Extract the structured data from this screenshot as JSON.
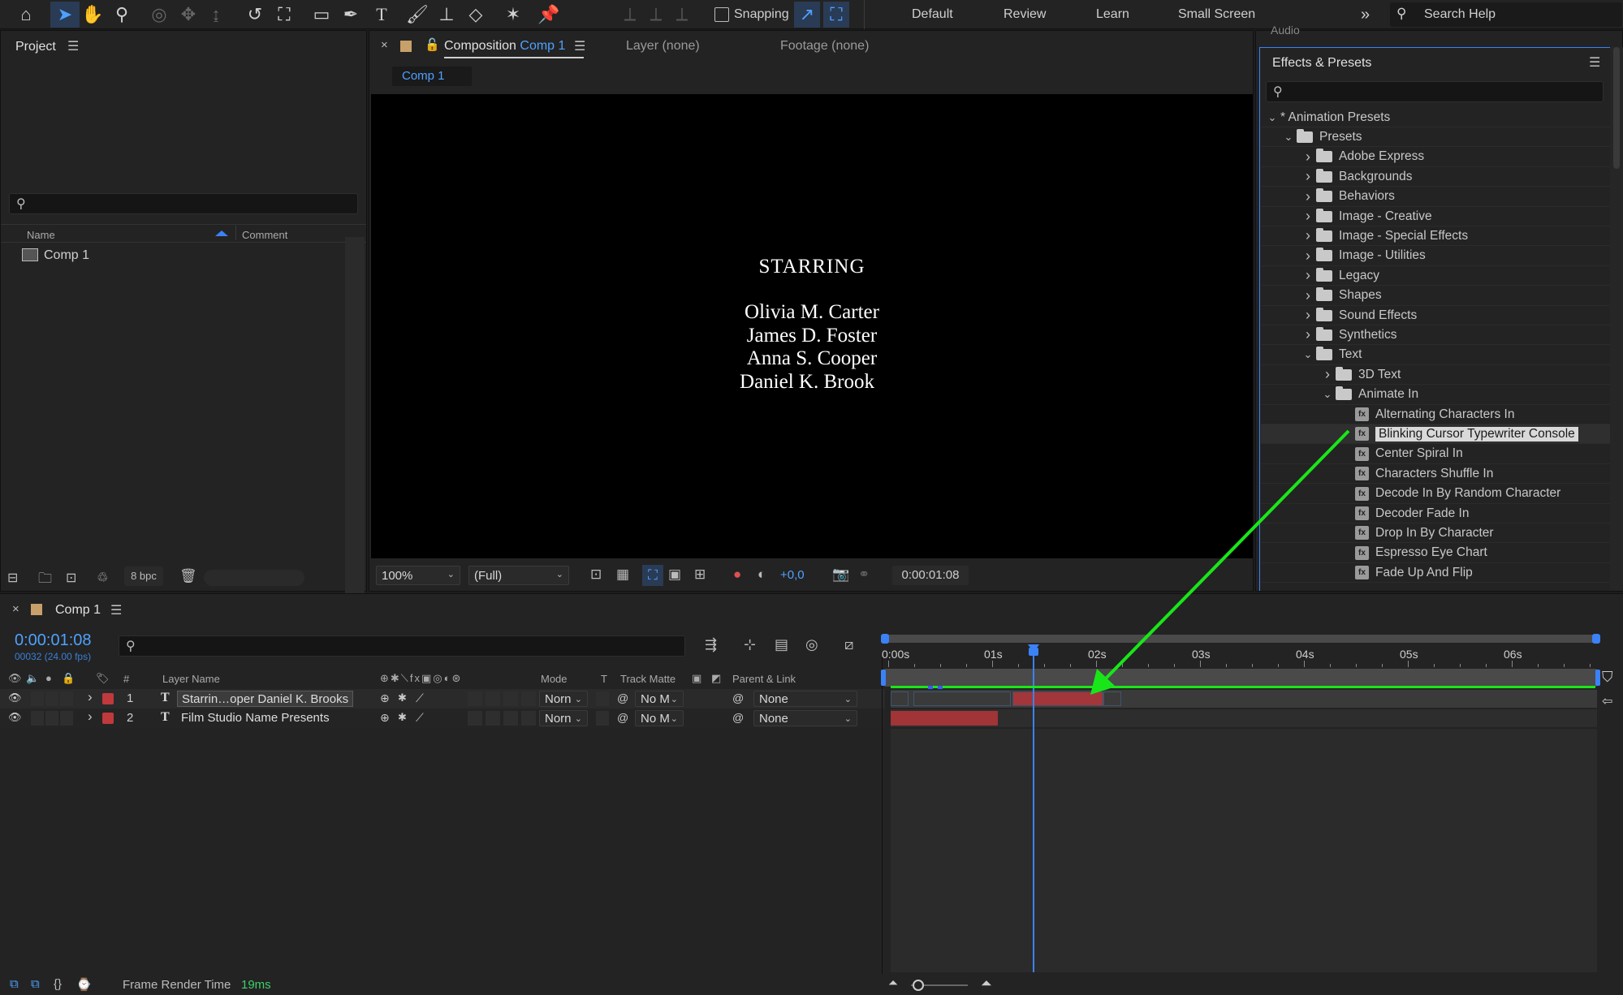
{
  "toolbar": {
    "snapping_label": "Snapping",
    "workspaces": [
      "Default",
      "Review",
      "Learn",
      "Small Screen"
    ],
    "more_label": "»",
    "search_placeholder": "Search Help",
    "accent": "#3b82f6"
  },
  "project": {
    "title": "Project",
    "columns": {
      "name": "Name",
      "comment": "Comment"
    },
    "items": [
      {
        "label": "Comp 1"
      }
    ],
    "bpc": "8 bpc"
  },
  "viewer": {
    "tabs": {
      "composition_prefix": "Composition",
      "composition_name": "Comp 1",
      "layer": "Layer (none)",
      "footage": "Footage (none)"
    },
    "breadcrumb": "Comp 1",
    "canvas_text": {
      "heading": "STARRING",
      "names": [
        "Olivia M. Carter",
        "James D. Foster",
        "Anna S. Cooper",
        "Daniel K. Brook"
      ]
    },
    "zoom": "100%",
    "resolution": "(Full)",
    "exposure": "+0,0",
    "timecode": "0:00:01:08"
  },
  "effects": {
    "title": "Effects & Presets",
    "clipped_header": "Audio",
    "tree": [
      {
        "label": "* Animation Presets",
        "level": 0,
        "state": "open",
        "kind": "none"
      },
      {
        "label": "Presets",
        "level": 1,
        "state": "open",
        "kind": "folder"
      },
      {
        "label": "Adobe Express",
        "level": 2,
        "state": "closed",
        "kind": "folder"
      },
      {
        "label": "Backgrounds",
        "level": 2,
        "state": "closed",
        "kind": "folder"
      },
      {
        "label": "Behaviors",
        "level": 2,
        "state": "closed",
        "kind": "folder"
      },
      {
        "label": "Image - Creative",
        "level": 2,
        "state": "closed",
        "kind": "folder"
      },
      {
        "label": "Image - Special Effects",
        "level": 2,
        "state": "closed",
        "kind": "folder"
      },
      {
        "label": "Image - Utilities",
        "level": 2,
        "state": "closed",
        "kind": "folder"
      },
      {
        "label": "Legacy",
        "level": 2,
        "state": "closed",
        "kind": "folder"
      },
      {
        "label": "Shapes",
        "level": 2,
        "state": "closed",
        "kind": "folder"
      },
      {
        "label": "Sound Effects",
        "level": 2,
        "state": "closed",
        "kind": "folder"
      },
      {
        "label": "Synthetics",
        "level": 2,
        "state": "closed",
        "kind": "folder"
      },
      {
        "label": "Text",
        "level": 2,
        "state": "open",
        "kind": "folder"
      },
      {
        "label": "3D Text",
        "level": 3,
        "state": "closed",
        "kind": "folder"
      },
      {
        "label": "Animate In",
        "level": 3,
        "state": "open",
        "kind": "folder"
      },
      {
        "label": "Alternating Characters In",
        "level": 4,
        "state": "leaf",
        "kind": "preset"
      },
      {
        "label": "Blinking Cursor Typewriter Console",
        "level": 4,
        "state": "leaf",
        "kind": "preset",
        "selected": true
      },
      {
        "label": "Center Spiral In",
        "level": 4,
        "state": "leaf",
        "kind": "preset"
      },
      {
        "label": "Characters Shuffle In",
        "level": 4,
        "state": "leaf",
        "kind": "preset"
      },
      {
        "label": "Decode In By Random Character",
        "level": 4,
        "state": "leaf",
        "kind": "preset"
      },
      {
        "label": "Decoder Fade In",
        "level": 4,
        "state": "leaf",
        "kind": "preset"
      },
      {
        "label": "Drop In By Character",
        "level": 4,
        "state": "leaf",
        "kind": "preset"
      },
      {
        "label": "Espresso Eye Chart",
        "level": 4,
        "state": "leaf",
        "kind": "preset"
      },
      {
        "label": "Fade Up And Flip",
        "level": 4,
        "state": "leaf",
        "kind": "preset"
      }
    ]
  },
  "timeline": {
    "tab": "Comp 1",
    "timecode": "0:00:01:08",
    "frames": "00032 (24.00 fps)",
    "columns": {
      "num": "#",
      "layer_name": "Layer Name",
      "mode": "Mode",
      "t": "T",
      "track_matte": "Track Matte",
      "parent": "Parent & Link"
    },
    "ruler": [
      "0:00s",
      "01s",
      "02s",
      "03s",
      "04s",
      "05s",
      "06s"
    ],
    "layers": [
      {
        "num": "1",
        "name": "Starrin…oper Daniel K. Brooks",
        "mode": "Norn",
        "matte": "No M",
        "parent": "None",
        "color": "#c0393c"
      },
      {
        "num": "2",
        "name": "Film Studio Name Presents",
        "mode": "Norn",
        "matte": "No M",
        "parent": "None",
        "color": "#c0393c"
      }
    ],
    "annotation_color": "#19e619"
  },
  "status": {
    "label": "Frame Render Time",
    "value": "19ms"
  }
}
